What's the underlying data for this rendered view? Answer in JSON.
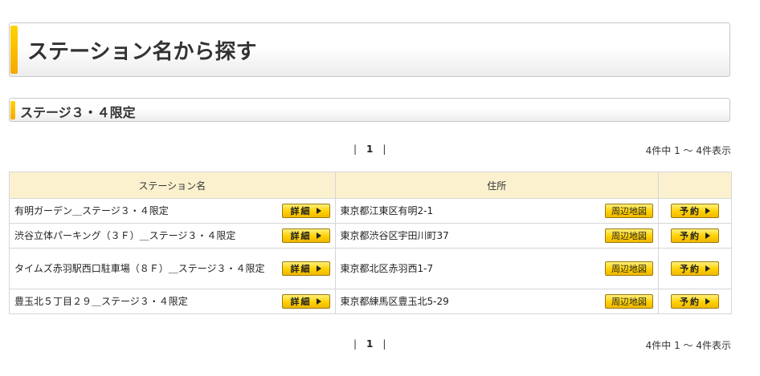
{
  "header": {
    "title": "ステーション名から探す"
  },
  "section": {
    "title": "ステージ３・４限定"
  },
  "pagination": {
    "separator": "|",
    "current_page": "1",
    "count_text": "4件中 1 ～ 4件表示"
  },
  "table": {
    "headers": {
      "name": "ステーション名",
      "address": "住所",
      "reserve": ""
    },
    "buttons": {
      "detail": "詳細",
      "map": "周辺地図",
      "reserve": "予約"
    },
    "rows": [
      {
        "name": "有明ガーデン＿ステージ３・４限定",
        "address": "東京都江東区有明2-1"
      },
      {
        "name": "渋谷立体パーキング（３Ｆ）＿ステージ３・４限定",
        "address": "東京都渋谷区宇田川町37"
      },
      {
        "name": "タイムズ赤羽駅西口駐車場（８Ｆ）＿ステージ３・４限定",
        "address": "東京都北区赤羽西1-7"
      },
      {
        "name": "豊玉北５丁目２９＿ステージ３・４限定",
        "address": "東京都練馬区豊玉北5-29"
      }
    ]
  }
}
